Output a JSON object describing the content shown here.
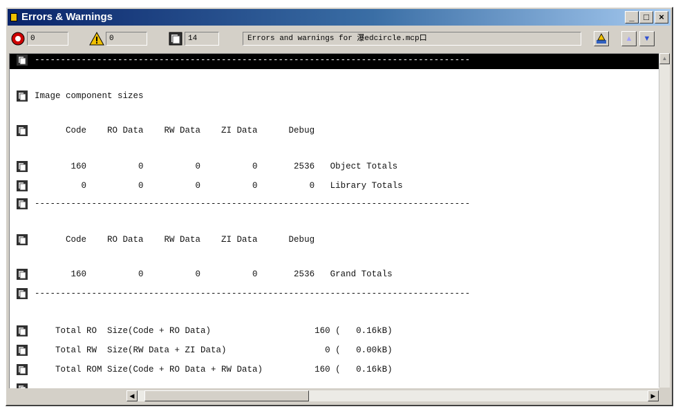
{
  "window": {
    "title": "Errors & Warnings",
    "minimize": "_",
    "maximize": "□",
    "close": "×"
  },
  "toolbar": {
    "errors_count": "0",
    "warnings_count": "0",
    "info_count": "14",
    "status_text": "Errors and warnings for 瀑edcircle.mcp口"
  },
  "messages": [
    "------------------------------------------------------------------------------------",
    "Image component sizes",
    "      Code    RO Data    RW Data    ZI Data      Debug",
    "       160          0          0          0       2536   Object Totals",
    "         0          0          0          0          0   Library Totals",
    "------------------------------------------------------------------------------------",
    "      Code    RO Data    RW Data    ZI Data      Debug",
    "       160          0          0          0       2536   Grand Totals",
    "------------------------------------------------------------------------------------",
    "    Total RO  Size(Code + RO Data)                    160 (   0.16kB)",
    "    Total RW  Size(RW Data + ZI Data)                   0 (   0.00kB)",
    "    Total ROM Size(Code + RO Data + RW Data)          160 (   0.16kB)",
    "------------------------------------------------------------------------------------"
  ],
  "colors": {
    "titlebar_start": "#0a246a",
    "titlebar_end": "#a6caf0",
    "selected_row": "#000000",
    "error": "#cc0000",
    "warning": "#f0c000"
  }
}
